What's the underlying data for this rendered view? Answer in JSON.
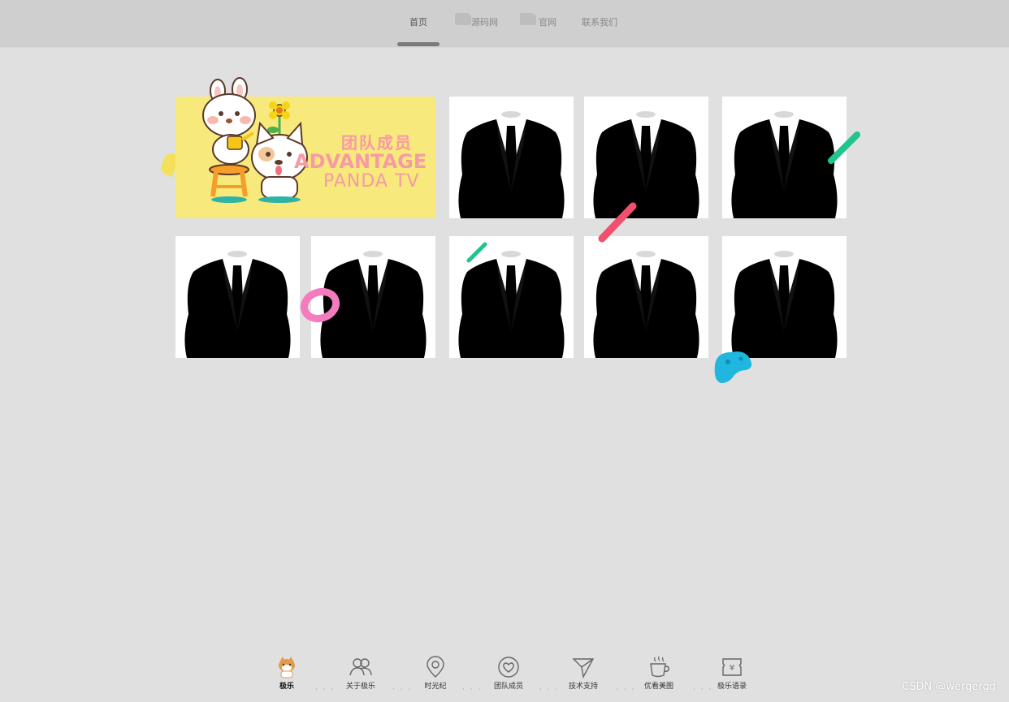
{
  "nav": {
    "items": [
      {
        "label": "首页",
        "active": true
      },
      {
        "label": "源码网",
        "active": false
      },
      {
        "label": "官网",
        "active": false
      },
      {
        "label": "联系我们",
        "active": false
      }
    ]
  },
  "banner": {
    "title_cn": "团队成员",
    "title_en": "ADVANTAGE",
    "subtitle": "PANDA TV"
  },
  "members": {
    "count": 9,
    "image_icon": "suit-silhouette-icon"
  },
  "bottom_nav": {
    "items": [
      {
        "label": "极乐",
        "icon": "shiba-dog-icon",
        "active": true
      },
      {
        "label": "关于极乐",
        "icon": "group-icon",
        "active": false
      },
      {
        "label": "时光纪",
        "icon": "location-pin-icon",
        "active": false
      },
      {
        "label": "团队成员",
        "icon": "heart-circle-icon",
        "active": false
      },
      {
        "label": "技术支持",
        "icon": "send-icon",
        "active": false
      },
      {
        "label": "优看美图",
        "icon": "coffee-cup-icon",
        "active": false
      },
      {
        "label": "极乐语录",
        "icon": "ticket-yen-icon",
        "active": false
      }
    ],
    "separator": "· · ·"
  },
  "watermark": "CSDN @wergergg",
  "colors": {
    "banner_bg": "#f8e97c",
    "banner_text": "#f79aa4",
    "accent_green": "#1fc48e",
    "accent_pink": "#f0506e",
    "accent_donut": "#f47bbd",
    "accent_blue": "#1fb6e0"
  }
}
